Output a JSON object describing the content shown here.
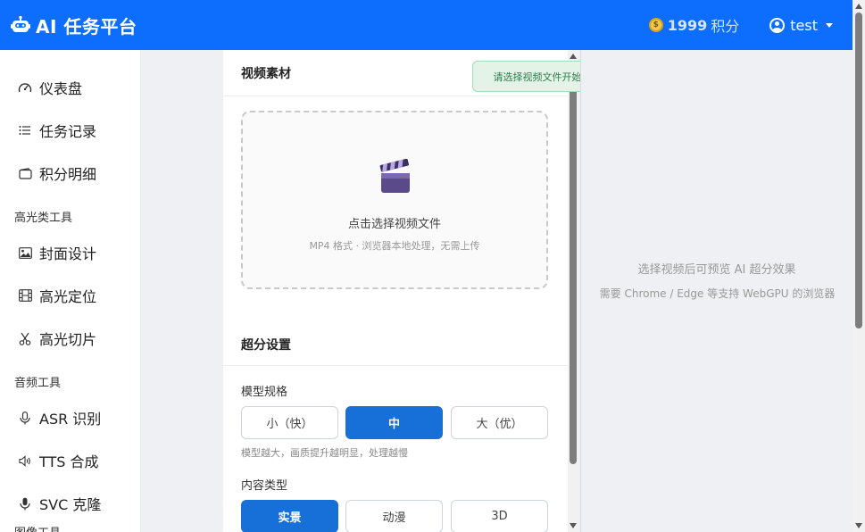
{
  "header": {
    "brand": "AI 任务平台",
    "points_value": "1999",
    "points_unit": "积分",
    "username": "test"
  },
  "sidebar": {
    "items": [
      {
        "label": "仪表盘",
        "icon": "dashboard-icon"
      },
      {
        "label": "任务记录",
        "icon": "list-icon"
      },
      {
        "label": "积分明细",
        "icon": "wallet-icon"
      }
    ],
    "sections": [
      {
        "title": "高光类工具",
        "items": [
          {
            "label": "封面设计",
            "icon": "image-icon"
          },
          {
            "label": "高光定位",
            "icon": "film-icon"
          },
          {
            "label": "高光切片",
            "icon": "scissors-icon"
          }
        ]
      },
      {
        "title": "音频工具",
        "items": [
          {
            "label": "ASR 识别",
            "icon": "mic-icon"
          },
          {
            "label": "TTS 合成",
            "icon": "volume-icon"
          },
          {
            "label": "SVC 克隆",
            "icon": "mic-icon"
          }
        ]
      },
      {
        "title": "图像工具"
      }
    ]
  },
  "main": {
    "video_section_title": "视频素材",
    "dropzone_title": "点击选择视频文件",
    "dropzone_sub": "MP4 格式 · 浏览器本地处理，无需上传",
    "settings_title": "超分设置",
    "model_label": "模型规格",
    "model_options": [
      "小（快）",
      "中",
      "大（优）"
    ],
    "model_selected": "中",
    "model_hint": "模型越大，画质提升越明显，处理越慢",
    "content_label": "内容类型",
    "content_options": [
      "实景",
      "动漫",
      "3D"
    ],
    "content_selected": "实景"
  },
  "toast": "请选择视频文件开始",
  "preview": {
    "title": "选择视频后可预览 AI 超分效果",
    "subtitle": "需要 Chrome / Edge 等支持 WebGPU 的浏览器"
  },
  "colors": {
    "header_bg": "#0d6efd",
    "accent": "#1670d8",
    "toast_bg": "#e3f3e7",
    "toast_text": "#2e7d4b"
  }
}
